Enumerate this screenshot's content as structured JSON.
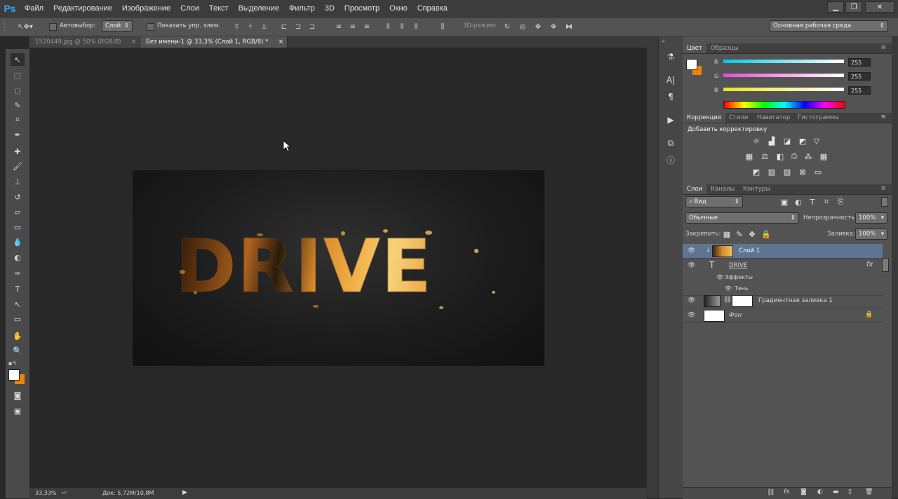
{
  "app": {
    "logo": "Ps"
  },
  "menu": [
    "Файл",
    "Редактирование",
    "Изображение",
    "Слои",
    "Текст",
    "Выделение",
    "Фильтр",
    "3D",
    "Просмотр",
    "Окно",
    "Справка"
  ],
  "window_controls": [
    "minimize-icon",
    "restore-icon",
    "close-icon"
  ],
  "options_bar": {
    "auto_select_label": "Автовыбор:",
    "auto_select_value": "Слой",
    "show_transform_label": "Показать упр. элем.",
    "mode3d_label": "3D-режим:",
    "workspace": "Основная рабочая среда"
  },
  "tabs": [
    {
      "label": "1520449.jpg @ 50% (RGB/8)",
      "active": false
    },
    {
      "label": "Без имени-1 @ 33,3% (Слой 1, RGB/8) *",
      "active": true
    }
  ],
  "tools": [
    "move-icon",
    "marquee-icon",
    "lasso-icon",
    "quick-select-icon",
    "crop-icon",
    "eyedropper-icon",
    "healing-icon",
    "brush-icon",
    "stamp-icon",
    "history-brush-icon",
    "eraser-icon",
    "gradient-icon",
    "blur-icon",
    "dodge-icon",
    "pen-icon",
    "type-icon",
    "path-select-icon",
    "shape-icon",
    "hand-icon",
    "zoom-icon"
  ],
  "canvas": {
    "artwork_text": "DRIVE"
  },
  "status": {
    "zoom": "33,33%",
    "doc": "Док: 5,72M/10,8M"
  },
  "color_panel": {
    "tabs": [
      {
        "label": "Цвет",
        "active": true
      },
      {
        "label": "Образцы",
        "active": false
      }
    ],
    "channels": [
      {
        "label": "R",
        "value": "255",
        "color": "#00c8e6"
      },
      {
        "label": "G",
        "value": "255",
        "color": "#e64bd2"
      },
      {
        "label": "B",
        "value": "255",
        "color": "#e6e61e"
      }
    ],
    "foreground": "#ffffff",
    "background": "#f0820a"
  },
  "adjustments_panel": {
    "tabs": [
      {
        "label": "Коррекция",
        "active": true
      },
      {
        "label": "Стили",
        "active": false
      },
      {
        "label": "Навигатор",
        "active": false
      },
      {
        "label": "Гистограмма",
        "active": false
      }
    ],
    "title": "Добавить корректировку",
    "icons": [
      "brightness-icon",
      "levels-icon",
      "curves-icon",
      "exposure-icon",
      "vibrance-icon",
      "hue-sat-icon",
      "color-balance-icon",
      "bw-icon",
      "photo-filter-icon",
      "channel-mixer-icon",
      "color-lookup-icon",
      "invert-icon",
      "posterize-icon",
      "threshold-icon",
      "selective-color-icon",
      "gradient-map-icon"
    ]
  },
  "layers_panel": {
    "tabs": [
      {
        "label": "Слои",
        "active": true
      },
      {
        "label": "Каналы",
        "active": false
      },
      {
        "label": "Контуры",
        "active": false
      }
    ],
    "filter": "Вид",
    "blend_mode": "Обычные",
    "opacity_label": "Непрозрачность:",
    "opacity": "100%",
    "lock_label": "Закрепить:",
    "fill_label": "Заливка:",
    "fill": "100%",
    "layers": [
      {
        "name": "Слой 1",
        "selected": true
      },
      {
        "name": "DRIVE",
        "type": "text"
      },
      {
        "name": "Эффекты",
        "type": "effects"
      },
      {
        "name": "Тень",
        "type": "effect"
      },
      {
        "name": "Градиентная заливка 1",
        "type": "fill"
      },
      {
        "name": "Фон",
        "type": "background"
      }
    ]
  }
}
